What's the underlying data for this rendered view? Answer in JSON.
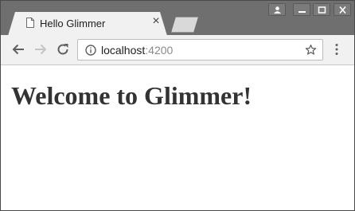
{
  "tab": {
    "title": "Hello Glimmer"
  },
  "address_bar": {
    "host": "localhost",
    "port": ":4200"
  },
  "page": {
    "heading": "Welcome to Glimmer!"
  },
  "colors": {
    "titlebar": "#6f6f6f",
    "toolbar": "#f1f1f1",
    "heading": "#333333"
  },
  "icons": {
    "tab": "page-icon",
    "nav": [
      "back-arrow-icon",
      "forward-arrow-icon",
      "reload-icon"
    ],
    "omnibox": [
      "info-icon",
      "star-icon"
    ],
    "menu": "menu-dots-icon",
    "window": [
      "user-icon",
      "minimize-icon",
      "maximize-icon",
      "close-icon"
    ]
  }
}
